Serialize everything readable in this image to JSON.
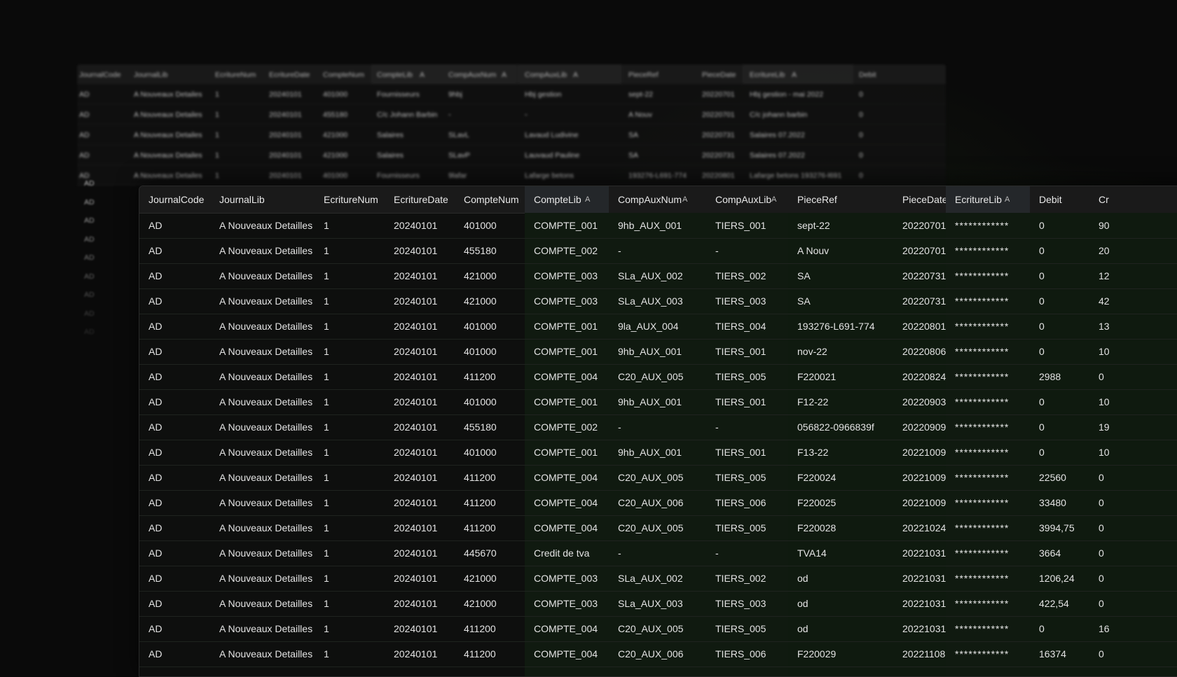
{
  "background_table": {
    "columns": [
      "JournalCode",
      "JournalLib",
      "EcritureNum",
      "EcritureDate",
      "CompteNum",
      "CompteLib",
      "CompAuxNum",
      "CompAuxLib",
      "PieceRef",
      "PieceDate",
      "EcritureLib",
      "Debit"
    ],
    "sort_indicator": "A",
    "rows": [
      [
        "AD",
        "A Nouveaux Detailes",
        "1",
        "20240101",
        "401000",
        "Fournisseurs",
        "9hbj",
        "Hbj gestion",
        "sept-22",
        "20220701",
        "Hbj gestion - mai 2022",
        "0"
      ],
      [
        "AD",
        "A Nouveaux Detailes",
        "1",
        "20240101",
        "455180",
        "C/c Johann Barbin",
        "-",
        "-",
        "A Nouv",
        "20220701",
        "C/c johann barbin",
        "0"
      ],
      [
        "AD",
        "A Nouveaux Detailes",
        "1",
        "20240101",
        "421000",
        "Salaires",
        "SLavL",
        "Lavaud Ludivine",
        "SA",
        "20220731",
        "Salaires 07.2022",
        "0"
      ],
      [
        "AD",
        "A Nouveaux Detailes",
        "1",
        "20240101",
        "421000",
        "Salaires",
        "SLavP",
        "Lauvaud Pauline",
        "SA",
        "20220731",
        "Salaires 07.2022",
        "0"
      ],
      [
        "AD",
        "A Nouveaux Detailes",
        "1",
        "20240101",
        "401000",
        "Fournisseurs",
        "9lafar",
        "Lafarge betons",
        "193276-L691-774",
        "20220801",
        "Lafarge betons 193276-l691",
        "0"
      ]
    ],
    "trailing_codes": [
      "AD",
      "AD",
      "AD",
      "AD",
      "AD",
      "AD",
      "AD",
      "AD",
      "AD"
    ]
  },
  "main_table": {
    "columns": [
      {
        "label": "JournalCode",
        "sorted": false
      },
      {
        "label": "JournalLib",
        "sorted": false
      },
      {
        "label": "EcritureNum",
        "sorted": false
      },
      {
        "label": "EcritureDate",
        "sorted": false
      },
      {
        "label": "CompteNum",
        "sorted": false
      },
      {
        "label": "CompteLib",
        "sorted": true,
        "sort": "A"
      },
      {
        "label": "CompAuxNum",
        "sorted": false,
        "sort": "A"
      },
      {
        "label": "CompAuxLib",
        "sorted": false,
        "sort": "A"
      },
      {
        "label": "PieceRef",
        "sorted": false
      },
      {
        "label": "PieceDate",
        "sorted": false
      },
      {
        "label": "EcritureLib",
        "sorted": true,
        "sort": "A"
      },
      {
        "label": "Debit",
        "sorted": false
      },
      {
        "label": "Cr",
        "sorted": false
      }
    ],
    "rows": [
      [
        "AD",
        "A Nouveaux Detailles",
        "1",
        "20240101",
        "401000",
        "COMPTE_001",
        "9hb_AUX_001",
        "TIERS_001",
        "sept-22",
        "20220701",
        "************",
        "0",
        "90"
      ],
      [
        "AD",
        "A Nouveaux Detailles",
        "1",
        "20240101",
        "455180",
        "COMPTE_002",
        "-",
        "-",
        "A Nouv",
        "20220701",
        "************",
        "0",
        "20"
      ],
      [
        "AD",
        "A Nouveaux Detailles",
        "1",
        "20240101",
        "421000",
        "COMPTE_003",
        "SLa_AUX_002",
        "TIERS_002",
        "SA",
        "20220731",
        "************",
        "0",
        "12"
      ],
      [
        "AD",
        "A Nouveaux Detailles",
        "1",
        "20240101",
        "421000",
        "COMPTE_003",
        "SLa_AUX_003",
        "TIERS_003",
        "SA",
        "20220731",
        "************",
        "0",
        "42"
      ],
      [
        "AD",
        "A Nouveaux Detailles",
        "1",
        "20240101",
        "401000",
        "COMPTE_001",
        "9la_AUX_004",
        "TIERS_004",
        "193276-L691-774",
        "20220801",
        "************",
        "0",
        "13"
      ],
      [
        "AD",
        "A Nouveaux Detailles",
        "1",
        "20240101",
        "401000",
        "COMPTE_001",
        "9hb_AUX_001",
        "TIERS_001",
        "nov-22",
        "20220806",
        "************",
        "0",
        "10"
      ],
      [
        "AD",
        "A Nouveaux Detailles",
        "1",
        "20240101",
        "411200",
        "COMPTE_004",
        "C20_AUX_005",
        "TIERS_005",
        "F220021",
        "20220824",
        "************",
        "2988",
        "0"
      ],
      [
        "AD",
        "A Nouveaux Detailles",
        "1",
        "20240101",
        "401000",
        "COMPTE_001",
        "9hb_AUX_001",
        "TIERS_001",
        "F12-22",
        "20220903",
        "************",
        "0",
        "10"
      ],
      [
        "AD",
        "A Nouveaux Detailles",
        "1",
        "20240101",
        "455180",
        "COMPTE_002",
        "-",
        "-",
        "056822-0966839f",
        "20220909",
        "************",
        "0",
        "19"
      ],
      [
        "AD",
        "A Nouveaux Detailles",
        "1",
        "20240101",
        "401000",
        "COMPTE_001",
        "9hb_AUX_001",
        "TIERS_001",
        "F13-22",
        "20221009",
        "************",
        "0",
        "10"
      ],
      [
        "AD",
        "A Nouveaux Detailles",
        "1",
        "20240101",
        "411200",
        "COMPTE_004",
        "C20_AUX_005",
        "TIERS_005",
        "F220024",
        "20221009",
        "************",
        "22560",
        "0"
      ],
      [
        "AD",
        "A Nouveaux Detailles",
        "1",
        "20240101",
        "411200",
        "COMPTE_004",
        "C20_AUX_006",
        "TIERS_006",
        "F220025",
        "20221009",
        "************",
        "33480",
        "0"
      ],
      [
        "AD",
        "A Nouveaux Detailles",
        "1",
        "20240101",
        "411200",
        "COMPTE_004",
        "C20_AUX_005",
        "TIERS_005",
        "F220028",
        "20221024",
        "************",
        "3994,75",
        "0"
      ],
      [
        "AD",
        "A Nouveaux Detailles",
        "1",
        "20240101",
        "445670",
        "Credit de tva",
        "-",
        "-",
        "TVA14",
        "20221031",
        "************",
        "3664",
        "0"
      ],
      [
        "AD",
        "A Nouveaux Detailles",
        "1",
        "20240101",
        "421000",
        "COMPTE_003",
        "SLa_AUX_002",
        "TIERS_002",
        "od",
        "20221031",
        "************",
        "1206,24",
        "0"
      ],
      [
        "AD",
        "A Nouveaux Detailles",
        "1",
        "20240101",
        "421000",
        "COMPTE_003",
        "SLa_AUX_003",
        "TIERS_003",
        "od",
        "20221031",
        "************",
        "422,54",
        "0"
      ],
      [
        "AD",
        "A Nouveaux Detailles",
        "1",
        "20240101",
        "411200",
        "COMPTE_004",
        "C20_AUX_005",
        "TIERS_005",
        "od",
        "20221031",
        "************",
        "0",
        "16"
      ],
      [
        "AD",
        "A Nouveaux Detailles",
        "1",
        "20240101",
        "411200",
        "COMPTE_004",
        "C20_AUX_006",
        "TIERS_006",
        "F220029",
        "20221108",
        "************",
        "16374",
        "0"
      ]
    ]
  },
  "colors": {
    "background": "#0a0a0a",
    "header": "#1a1a1a",
    "sorted_header": "#24272a",
    "row_tint": "#101a10",
    "glow": "#3c6e28"
  }
}
